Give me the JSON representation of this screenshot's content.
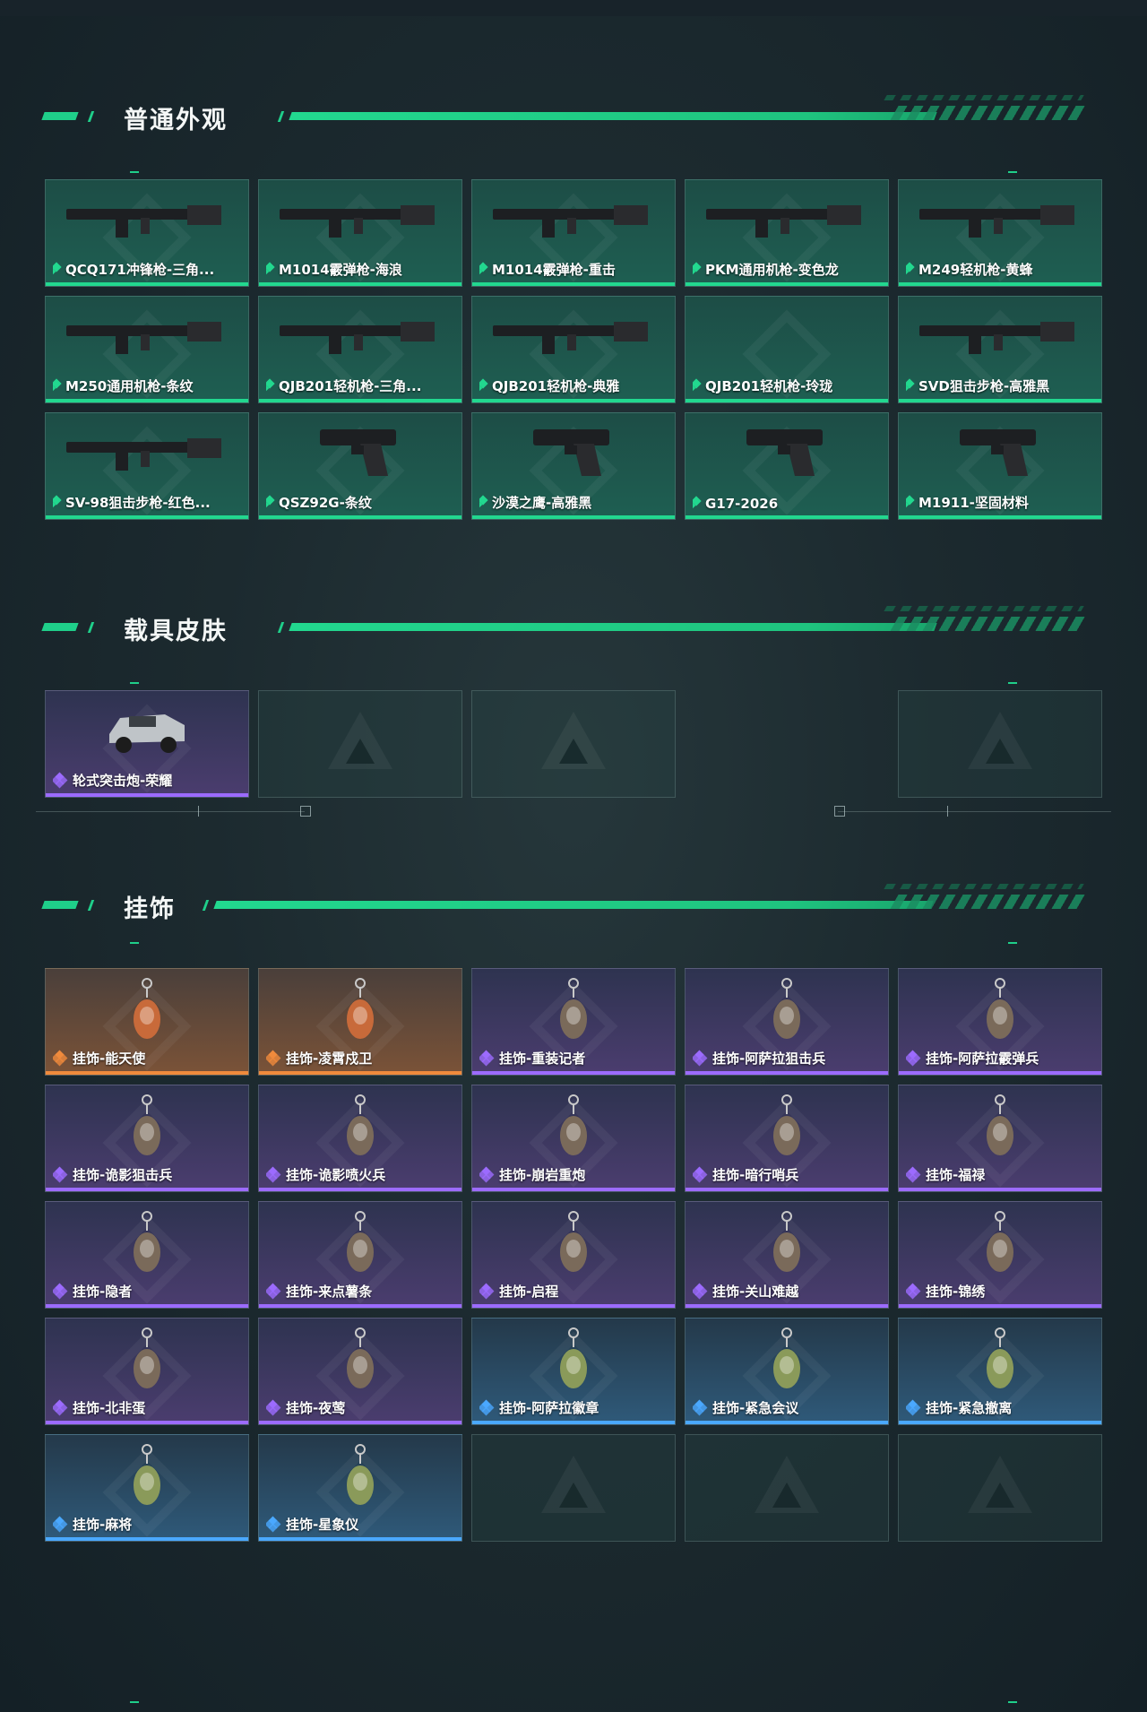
{
  "sections": {
    "weapons": {
      "title": "普通外观",
      "items": [
        {
          "label": "QCQ171冲锋枪-三角...",
          "rarity": "green",
          "icon": "smg-icon"
        },
        {
          "label": "M1014霰弹枪-海浪",
          "rarity": "green",
          "icon": "shotgun-icon"
        },
        {
          "label": "M1014霰弹枪-重击",
          "rarity": "green",
          "icon": "shotgun-icon"
        },
        {
          "label": "PKM通用机枪-变色龙",
          "rarity": "green",
          "icon": "machine-gun-icon"
        },
        {
          "label": "M249轻机枪-黄蜂",
          "rarity": "green",
          "icon": "machine-gun-icon"
        },
        {
          "label": "M250通用机枪-条纹",
          "rarity": "green",
          "icon": "machine-gun-icon"
        },
        {
          "label": "QJB201轻机枪-三角...",
          "rarity": "green",
          "icon": "rifle-icon"
        },
        {
          "label": "QJB201轻机枪-典雅",
          "rarity": "green",
          "icon": "rifle-icon"
        },
        {
          "label": "QJB201轻机枪-玲珑",
          "rarity": "green",
          "icon": "none"
        },
        {
          "label": "SVD狙击步枪-高雅黑",
          "rarity": "green",
          "icon": "sniper-rifle-icon"
        },
        {
          "label": "SV-98狙击步枪-红色...",
          "rarity": "green",
          "icon": "sniper-rifle-icon"
        },
        {
          "label": "QSZ92G-条纹",
          "rarity": "green",
          "icon": "pistol-icon"
        },
        {
          "label": "沙漠之鹰-高雅黑",
          "rarity": "green",
          "icon": "pistol-icon"
        },
        {
          "label": "G17-2026",
          "rarity": "green",
          "icon": "pistol-icon"
        },
        {
          "label": "M1911-坚固材料",
          "rarity": "green",
          "icon": "pistol-icon"
        }
      ]
    },
    "vehicles": {
      "title": "载具皮肤",
      "items": [
        {
          "label": "轮式突击炮-荣耀",
          "rarity": "purple",
          "icon": "vehicle-icon"
        }
      ]
    },
    "charms": {
      "title": "挂饰",
      "items": [
        {
          "label": "挂饰-能天使",
          "rarity": "orange"
        },
        {
          "label": "挂饰-凌霄戍卫",
          "rarity": "orange"
        },
        {
          "label": "挂饰-重装记者",
          "rarity": "purple"
        },
        {
          "label": "挂饰-阿萨拉狙击兵",
          "rarity": "purple"
        },
        {
          "label": "挂饰-阿萨拉霰弹兵",
          "rarity": "purple"
        },
        {
          "label": "挂饰-诡影狙击兵",
          "rarity": "purple"
        },
        {
          "label": "挂饰-诡影喷火兵",
          "rarity": "purple"
        },
        {
          "label": "挂饰-崩岩重炮",
          "rarity": "purple"
        },
        {
          "label": "挂饰-暗行哨兵",
          "rarity": "purple"
        },
        {
          "label": "挂饰-福禄",
          "rarity": "purple"
        },
        {
          "label": "挂饰-隐者",
          "rarity": "purple"
        },
        {
          "label": "挂饰-来点薯条",
          "rarity": "purple"
        },
        {
          "label": "挂饰-启程",
          "rarity": "purple"
        },
        {
          "label": "挂饰-关山难越",
          "rarity": "purple"
        },
        {
          "label": "挂饰-锦绣",
          "rarity": "purple"
        },
        {
          "label": "挂饰-北非蛋",
          "rarity": "purple"
        },
        {
          "label": "挂饰-夜莺",
          "rarity": "purple"
        },
        {
          "label": "挂饰-阿萨拉徽章",
          "rarity": "blue"
        },
        {
          "label": "挂饰-紧急会议",
          "rarity": "blue"
        },
        {
          "label": "挂饰-紧急撤离",
          "rarity": "blue"
        },
        {
          "label": "挂饰-麻将",
          "rarity": "blue"
        },
        {
          "label": "挂饰-星象仪",
          "rarity": "blue"
        }
      ]
    }
  },
  "colors": {
    "accent": "#22d88f",
    "purple": "#9c6bff",
    "orange": "#f08a3c",
    "blue": "#4aa8ff"
  }
}
